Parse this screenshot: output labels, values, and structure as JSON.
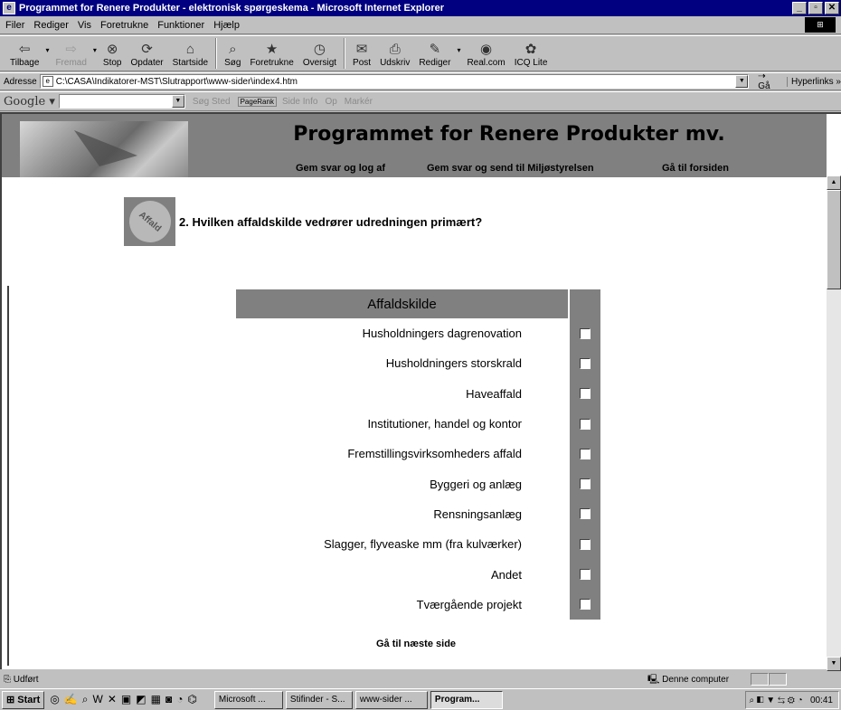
{
  "window": {
    "title": "Programmet for Renere Produkter - elektronisk spørgeskema - Microsoft Internet Explorer",
    "controls": [
      "_",
      "▫",
      "✕"
    ]
  },
  "menu": [
    "Filer",
    "Rediger",
    "Vis",
    "Foretrukne",
    "Funktioner",
    "Hjælp"
  ],
  "toolbar": [
    {
      "label": "Tilbage",
      "icon": "back-arrow-icon",
      "glyph": "⇦",
      "enabled": true
    },
    {
      "label": "Fremad",
      "icon": "forward-arrow-icon",
      "glyph": "⇨",
      "enabled": false
    },
    {
      "label": "Stop",
      "icon": "stop-icon",
      "glyph": "⊗",
      "enabled": true
    },
    {
      "label": "Opdater",
      "icon": "refresh-icon",
      "glyph": "⟳",
      "enabled": true
    },
    {
      "label": "Startside",
      "icon": "home-icon",
      "glyph": "⌂",
      "enabled": true
    },
    {
      "label": "Søg",
      "icon": "search-icon",
      "glyph": "⌕",
      "enabled": true
    },
    {
      "label": "Foretrukne",
      "icon": "favorites-icon",
      "glyph": "★",
      "enabled": true
    },
    {
      "label": "Oversigt",
      "icon": "history-icon",
      "glyph": "◷",
      "enabled": true
    },
    {
      "label": "Post",
      "icon": "mail-icon",
      "glyph": "✉",
      "enabled": true
    },
    {
      "label": "Udskriv",
      "icon": "print-icon",
      "glyph": "⎙",
      "enabled": true
    },
    {
      "label": "Rediger",
      "icon": "edit-icon",
      "glyph": "✎",
      "enabled": true
    },
    {
      "label": "Real.com",
      "icon": "realcom-icon",
      "glyph": "◉",
      "enabled": true
    },
    {
      "label": "ICQ Lite",
      "icon": "icq-icon",
      "glyph": "✿",
      "enabled": true
    }
  ],
  "address": {
    "label": "Adresse",
    "value": "C:\\CASA\\Indikatorer-MST\\Slutrapport\\www-sider\\index4.htm",
    "go": "Gå",
    "links": "Hyperlinks »"
  },
  "google": {
    "logo": "Google",
    "items": [
      "Søg Sted",
      "PageRank",
      "Side Info",
      "Op",
      "Markér"
    ]
  },
  "page": {
    "banner_title": "Programmet for Renere Produkter mv.",
    "nav": [
      "Gem svar og log af",
      "Gem svar og send til Miljøstyrelsen",
      "Gå til forsiden"
    ],
    "affald_icon_text": "Affald",
    "question": "2. Hvilken affaldskilde vedrører udredningen primært?",
    "table_header": "Affaldskilde",
    "options": [
      "Husholdningers dagrenovation",
      "Husholdningers storskrald",
      "Haveaffald",
      "Institutioner, handel og kontor",
      "Fremstillingsvirksomheders affald",
      "Byggeri og anlæg",
      "Rensningsanlæg",
      "Slagger, flyveaske mm (fra kulværker)",
      "Andet",
      "Tværgående projekt"
    ],
    "next": "Gå til næste side"
  },
  "status": {
    "text": "Udført",
    "zone": "Denne computer"
  },
  "taskbar": {
    "start": "Start",
    "tasks": [
      "Microsoft ...",
      "Stifinder - S...",
      "www-sider ...",
      "Program..."
    ],
    "active_task": 3,
    "clock": "00:41"
  }
}
